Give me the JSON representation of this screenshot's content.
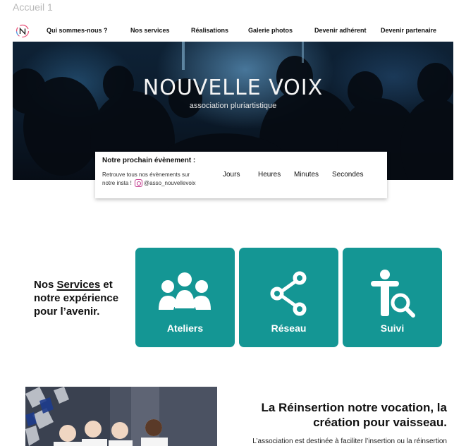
{
  "frame": {
    "label": "Accueil 1"
  },
  "nav": {
    "items": [
      {
        "label": "Qui sommes-nous ?"
      },
      {
        "label": "Nos services"
      },
      {
        "label": "Réalisations"
      },
      {
        "label": "Galerie photos"
      },
      {
        "label": "Devenir adhérent"
      },
      {
        "label": "Devenir partenaire"
      }
    ]
  },
  "hero": {
    "title": "NOUVELLE VOIX",
    "subtitle": "association pluriartistique"
  },
  "event": {
    "title": "Notre prochain évènement :",
    "text_line1": "Retrouve tous nos évènements sur",
    "text_line2": "notre insta !",
    "insta_handle": "@asso_nouvellevoix",
    "countdown_labels": [
      "Jours",
      "Heures",
      "Minutes",
      "Secondes"
    ]
  },
  "services": {
    "heading_part1": "Nos ",
    "heading_highlight": "Services",
    "heading_part2": " et notre expérience pour l’avenir.",
    "cards": [
      {
        "label": "Ateliers",
        "icon": "group-icon"
      },
      {
        "label": "Réseau",
        "icon": "share-icon"
      },
      {
        "label": "Suivi",
        "icon": "person-search-icon"
      }
    ],
    "accent": "#149694"
  },
  "promo": {
    "title_line1": "La Réinsertion notre vocation, la",
    "title_line2": "création pour vaisseau.",
    "text": "L’association est destinée à faciliter l’insertion ou la réinsertion"
  }
}
